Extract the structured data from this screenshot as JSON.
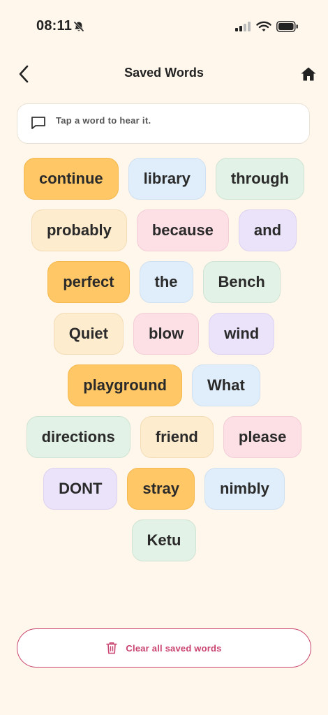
{
  "status": {
    "time": "08:11"
  },
  "header": {
    "title": "Saved Words"
  },
  "hint": {
    "text": "Tap a word to hear it."
  },
  "words": [
    {
      "label": "continue",
      "color": "orange"
    },
    {
      "label": "library",
      "color": "blue"
    },
    {
      "label": "through",
      "color": "green"
    },
    {
      "label": "probably",
      "color": "cream"
    },
    {
      "label": "because",
      "color": "pink"
    },
    {
      "label": "and",
      "color": "purple"
    },
    {
      "label": "perfect",
      "color": "orange"
    },
    {
      "label": "the",
      "color": "blue"
    },
    {
      "label": "Bench",
      "color": "green"
    },
    {
      "label": "Quiet",
      "color": "cream"
    },
    {
      "label": "blow",
      "color": "pink"
    },
    {
      "label": "wind",
      "color": "purple"
    },
    {
      "label": "playground",
      "color": "orange"
    },
    {
      "label": "What",
      "color": "blue"
    },
    {
      "label": "directions",
      "color": "green"
    },
    {
      "label": "friend",
      "color": "cream"
    },
    {
      "label": "please",
      "color": "pink"
    },
    {
      "label": "DONT",
      "color": "purple"
    },
    {
      "label": "stray",
      "color": "orange"
    },
    {
      "label": "nimbly",
      "color": "blue"
    },
    {
      "label": "Ketu",
      "color": "green"
    }
  ],
  "footer": {
    "clear_label": "Clear all saved words"
  },
  "colors": {
    "orange": "#ffc765",
    "blue": "#e0eefb",
    "green": "#e2f2e6",
    "cream": "#fdeccd",
    "pink": "#fde0e6",
    "purple": "#ebe3fa",
    "accent": "#c9436e",
    "background": "#fff6ec"
  },
  "icons": {
    "back": "chevron-left-icon",
    "home": "home-icon",
    "hint": "speech-bubble-icon",
    "clear": "trash-icon"
  }
}
